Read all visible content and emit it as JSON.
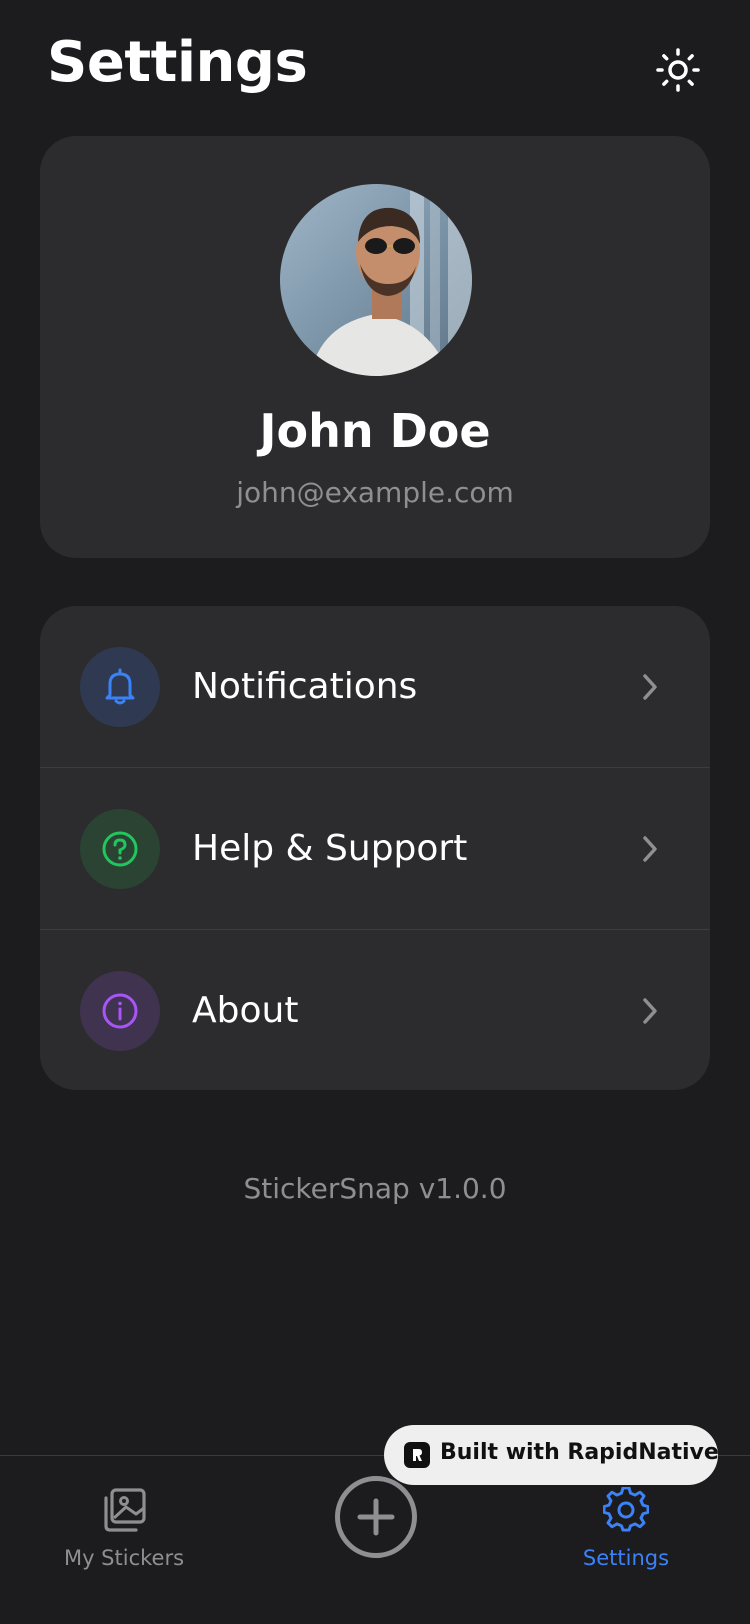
{
  "header": {
    "title": "Settings",
    "theme_icon": "sun-icon"
  },
  "profile": {
    "name": "John Doe",
    "email": "john@example.com"
  },
  "menu": {
    "items": [
      {
        "label": "Notifications",
        "icon": "bell-icon",
        "icon_color": "#3b82f6",
        "icon_bg": "#2f3a52"
      },
      {
        "label": "Help & Support",
        "icon": "question-circle-icon",
        "icon_color": "#22c55e",
        "icon_bg": "#2a4332"
      },
      {
        "label": "About",
        "icon": "info-circle-icon",
        "icon_color": "#a855f7",
        "icon_bg": "#3f3350"
      }
    ]
  },
  "footer": {
    "version": "StickerSnap v1.0.0"
  },
  "tabbar": {
    "tabs": [
      {
        "label": "My Stickers",
        "icon": "gallery-icon",
        "color": "#8e8e93"
      },
      {
        "label": "",
        "icon": "plus-circle-icon",
        "color": "#8e8e93"
      },
      {
        "label": "Settings",
        "icon": "gear-icon",
        "color": "#3b82f6"
      }
    ],
    "active_tab": "Settings"
  },
  "badge": {
    "text": "Built with RapidNative"
  },
  "colors": {
    "background": "#1c1c1e",
    "card": "#2c2c2e",
    "accent": "#3b82f6",
    "muted_text": "#8e8e93"
  }
}
